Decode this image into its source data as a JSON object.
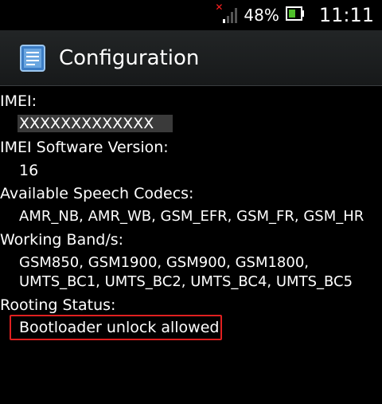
{
  "status_bar": {
    "battery_percent": "48%",
    "time": "11:11",
    "icons": [
      "signal-no-service-icon",
      "battery-icon"
    ],
    "accent_color": "#4fbf2a"
  },
  "action_bar": {
    "title": "Configuration",
    "icon": "configuration-app-icon"
  },
  "fields": {
    "imei_label": "IMEI:",
    "imei_value": "XXXXXXXXXXXXX",
    "imei_sv_label": "IMEI Software Version:",
    "imei_sv_value": "16",
    "codecs_label": "Available Speech Codecs:",
    "codecs_value": "AMR_NB, AMR_WB, GSM_EFR, GSM_FR, GSM_HR",
    "bands_label": "Working Band/s:",
    "bands_value_line1": "GSM850, GSM1900, GSM900, GSM1800,",
    "bands_value_line2": "UMTS_BC1, UMTS_BC2, UMTS_BC4, UMTS_BC5",
    "rooting_label": "Rooting Status:",
    "rooting_value": "Bootloader unlock allowed"
  },
  "colors": {
    "highlight_box": "#e02020",
    "background": "#000000"
  }
}
